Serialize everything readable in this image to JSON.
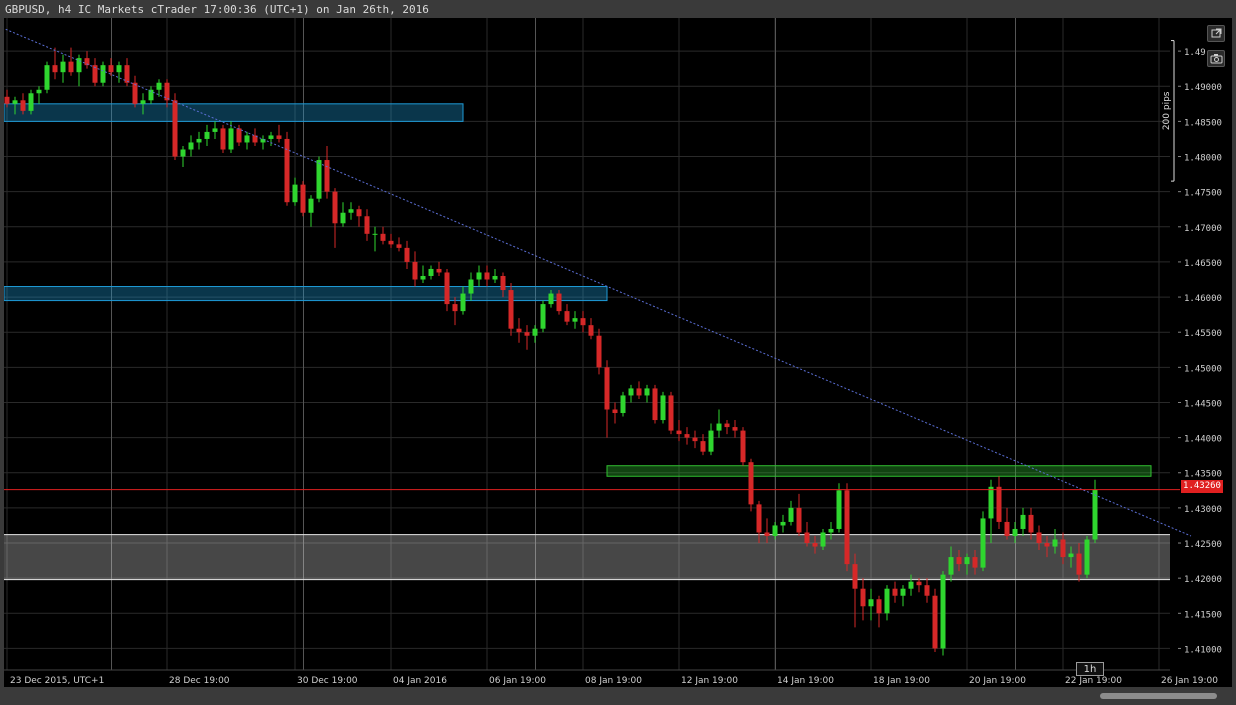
{
  "window": {
    "title": "GBPUSD, h4 IC Markets cTrader 17:00:36 (UTC+1) on Jan 26th, 2016",
    "timeframe_badge": "1h"
  },
  "colors": {
    "background": "#000000",
    "frame": "#3a3a3a",
    "grid": "#2a2a2a",
    "bull": "#2fd62f",
    "bear": "#d62828",
    "trendline": "#5b6fd6",
    "blue_zone": "#1e9bd7",
    "green_zone": "#30c030",
    "price_line": "#e02020",
    "axis_text": "#d0d0d0"
  },
  "chart_data": {
    "type": "candlestick",
    "symbol": "GBPUSD",
    "timeframe": "h4",
    "current_price": "1.43260",
    "ylim": [
      1.4075,
      1.499
    ],
    "y_ticks": [
      "1.49",
      "1.49000",
      "1.48500",
      "1.48000",
      "1.47500",
      "1.47000",
      "1.46500",
      "1.46000",
      "1.45500",
      "1.45000",
      "1.44500",
      "1.44000",
      "1.43500",
      "1.43000",
      "1.42500",
      "1.42000",
      "1.41500",
      "1.41000"
    ],
    "y_tick_values": [
      1.495,
      1.49,
      1.485,
      1.48,
      1.475,
      1.47,
      1.465,
      1.46,
      1.455,
      1.45,
      1.445,
      1.44,
      1.435,
      1.43,
      1.425,
      1.42,
      1.415,
      1.41
    ],
    "x_labels": [
      {
        "label": "23 Dec 2015, UTC+1",
        "bar": 0
      },
      {
        "label": "28 Dec 19:00",
        "bar": 20
      },
      {
        "label": "30 Dec 19:00",
        "bar": 36
      },
      {
        "label": "04 Jan 2016",
        "bar": 48
      },
      {
        "label": "06 Jan 19:00",
        "bar": 60
      },
      {
        "label": "08 Jan 19:00",
        "bar": 72
      },
      {
        "label": "12 Jan 19:00",
        "bar": 84
      },
      {
        "label": "14 Jan 19:00",
        "bar": 96
      },
      {
        "label": "18 Jan 19:00",
        "bar": 108
      },
      {
        "label": "20 Jan 19:00",
        "bar": 120
      },
      {
        "label": "22 Jan 19:00",
        "bar": 132
      },
      {
        "label": "26 Jan 19:00",
        "bar": 144
      }
    ],
    "vertical_gridlines_bars": [
      13,
      37,
      66,
      96,
      126
    ],
    "pips_label": "200 pips",
    "pips_range": [
      1.4965,
      1.4765
    ],
    "candles": [
      [
        1.4885,
        1.4895,
        1.487,
        1.4875
      ],
      [
        1.4875,
        1.4885,
        1.486,
        1.488
      ],
      [
        1.488,
        1.489,
        1.486,
        1.4865
      ],
      [
        1.4865,
        1.4895,
        1.486,
        1.489
      ],
      [
        1.489,
        1.49,
        1.4875,
        1.4895
      ],
      [
        1.4895,
        1.4935,
        1.489,
        1.493
      ],
      [
        1.493,
        1.4955,
        1.491,
        1.492
      ],
      [
        1.492,
        1.4945,
        1.4905,
        1.4935
      ],
      [
        1.4935,
        1.4955,
        1.4915,
        1.492
      ],
      [
        1.492,
        1.4945,
        1.49,
        1.494
      ],
      [
        1.494,
        1.495,
        1.4925,
        1.493
      ],
      [
        1.493,
        1.494,
        1.49,
        1.4905
      ],
      [
        1.4905,
        1.4935,
        1.49,
        1.493
      ],
      [
        1.493,
        1.494,
        1.4915,
        1.492
      ],
      [
        1.492,
        1.4935,
        1.4905,
        1.493
      ],
      [
        1.493,
        1.494,
        1.49,
        1.4905
      ],
      [
        1.4905,
        1.4915,
        1.487,
        1.4875
      ],
      [
        1.4875,
        1.489,
        1.486,
        1.488
      ],
      [
        1.488,
        1.49,
        1.4875,
        1.4895
      ],
      [
        1.4895,
        1.491,
        1.4885,
        1.4905
      ],
      [
        1.4905,
        1.491,
        1.487,
        1.488
      ],
      [
        1.488,
        1.489,
        1.4795,
        1.48
      ],
      [
        1.48,
        1.4815,
        1.4785,
        1.481
      ],
      [
        1.481,
        1.483,
        1.48,
        1.482
      ],
      [
        1.482,
        1.4835,
        1.481,
        1.4825
      ],
      [
        1.4825,
        1.4845,
        1.4815,
        1.4835
      ],
      [
        1.4835,
        1.485,
        1.4825,
        1.484
      ],
      [
        1.484,
        1.4845,
        1.4805,
        1.481
      ],
      [
        1.481,
        1.485,
        1.4805,
        1.484
      ],
      [
        1.484,
        1.4845,
        1.4815,
        1.482
      ],
      [
        1.482,
        1.4835,
        1.481,
        1.483
      ],
      [
        1.483,
        1.484,
        1.4815,
        1.482
      ],
      [
        1.482,
        1.483,
        1.481,
        1.4825
      ],
      [
        1.4825,
        1.4835,
        1.4815,
        1.483
      ],
      [
        1.483,
        1.4845,
        1.482,
        1.4825
      ],
      [
        1.4825,
        1.4835,
        1.473,
        1.4735
      ],
      [
        1.4735,
        1.477,
        1.473,
        1.476
      ],
      [
        1.476,
        1.4765,
        1.4715,
        1.472
      ],
      [
        1.472,
        1.4745,
        1.47,
        1.474
      ],
      [
        1.474,
        1.48,
        1.4735,
        1.4795
      ],
      [
        1.4795,
        1.4815,
        1.474,
        1.475
      ],
      [
        1.475,
        1.4755,
        1.467,
        1.4705
      ],
      [
        1.4705,
        1.4735,
        1.47,
        1.472
      ],
      [
        1.472,
        1.4735,
        1.471,
        1.4725
      ],
      [
        1.4725,
        1.473,
        1.47,
        1.4715
      ],
      [
        1.4715,
        1.4725,
        1.468,
        1.469
      ],
      [
        1.469,
        1.47,
        1.4665,
        1.469
      ],
      [
        1.469,
        1.47,
        1.4675,
        1.468
      ],
      [
        1.468,
        1.469,
        1.467,
        1.4675
      ],
      [
        1.4675,
        1.4685,
        1.4665,
        1.467
      ],
      [
        1.467,
        1.468,
        1.464,
        1.465
      ],
      [
        1.465,
        1.4665,
        1.4615,
        1.4625
      ],
      [
        1.4625,
        1.4645,
        1.462,
        1.463
      ],
      [
        1.463,
        1.4645,
        1.4625,
        1.464
      ],
      [
        1.464,
        1.465,
        1.463,
        1.4635
      ],
      [
        1.4635,
        1.464,
        1.458,
        1.459
      ],
      [
        1.459,
        1.46,
        1.456,
        1.458
      ],
      [
        1.458,
        1.4615,
        1.4575,
        1.4605
      ],
      [
        1.4605,
        1.4635,
        1.4595,
        1.4625
      ],
      [
        1.4625,
        1.4645,
        1.4615,
        1.4635
      ],
      [
        1.4635,
        1.4645,
        1.4615,
        1.4625
      ],
      [
        1.4625,
        1.464,
        1.462,
        1.463
      ],
      [
        1.463,
        1.4635,
        1.46,
        1.461
      ],
      [
        1.461,
        1.462,
        1.4545,
        1.4555
      ],
      [
        1.4555,
        1.457,
        1.4535,
        1.455
      ],
      [
        1.455,
        1.456,
        1.4525,
        1.4545
      ],
      [
        1.4545,
        1.456,
        1.4535,
        1.4555
      ],
      [
        1.4555,
        1.4595,
        1.455,
        1.459
      ],
      [
        1.459,
        1.461,
        1.4585,
        1.4605
      ],
      [
        1.4605,
        1.461,
        1.4575,
        1.458
      ],
      [
        1.458,
        1.459,
        1.456,
        1.4565
      ],
      [
        1.4565,
        1.458,
        1.4555,
        1.457
      ],
      [
        1.457,
        1.458,
        1.455,
        1.456
      ],
      [
        1.456,
        1.457,
        1.454,
        1.4545
      ],
      [
        1.4545,
        1.4555,
        1.449,
        1.45
      ],
      [
        1.45,
        1.451,
        1.44,
        1.444
      ],
      [
        1.444,
        1.445,
        1.442,
        1.4435
      ],
      [
        1.4435,
        1.4465,
        1.443,
        1.446
      ],
      [
        1.446,
        1.4475,
        1.445,
        1.447
      ],
      [
        1.447,
        1.448,
        1.4455,
        1.446
      ],
      [
        1.446,
        1.4475,
        1.445,
        1.447
      ],
      [
        1.447,
        1.4475,
        1.442,
        1.4425
      ],
      [
        1.4425,
        1.4465,
        1.442,
        1.446
      ],
      [
        1.446,
        1.4465,
        1.4405,
        1.441
      ],
      [
        1.441,
        1.4425,
        1.4395,
        1.4405
      ],
      [
        1.4405,
        1.4415,
        1.439,
        1.44
      ],
      [
        1.44,
        1.441,
        1.4385,
        1.4395
      ],
      [
        1.4395,
        1.4405,
        1.4375,
        1.438
      ],
      [
        1.438,
        1.442,
        1.4375,
        1.441
      ],
      [
        1.441,
        1.444,
        1.44,
        1.442
      ],
      [
        1.442,
        1.4425,
        1.4405,
        1.4415
      ],
      [
        1.4415,
        1.4425,
        1.44,
        1.441
      ],
      [
        1.441,
        1.4415,
        1.436,
        1.4365
      ],
      [
        1.4365,
        1.437,
        1.4295,
        1.4305
      ],
      [
        1.4305,
        1.431,
        1.425,
        1.4265
      ],
      [
        1.4265,
        1.4285,
        1.425,
        1.426
      ],
      [
        1.426,
        1.428,
        1.4255,
        1.4275
      ],
      [
        1.4275,
        1.429,
        1.4265,
        1.428
      ],
      [
        1.428,
        1.431,
        1.4275,
        1.43
      ],
      [
        1.43,
        1.432,
        1.426,
        1.4265
      ],
      [
        1.4265,
        1.428,
        1.4245,
        1.425
      ],
      [
        1.425,
        1.426,
        1.4235,
        1.4245
      ],
      [
        1.4245,
        1.427,
        1.424,
        1.4265
      ],
      [
        1.4265,
        1.428,
        1.4255,
        1.427
      ],
      [
        1.427,
        1.4335,
        1.4265,
        1.4325
      ],
      [
        1.4325,
        1.4335,
        1.421,
        1.422
      ],
      [
        1.422,
        1.4235,
        1.413,
        1.4185
      ],
      [
        1.4185,
        1.42,
        1.414,
        1.416
      ],
      [
        1.416,
        1.4185,
        1.414,
        1.417
      ],
      [
        1.417,
        1.4175,
        1.413,
        1.415
      ],
      [
        1.415,
        1.419,
        1.414,
        1.4185
      ],
      [
        1.4185,
        1.4195,
        1.4165,
        1.4175
      ],
      [
        1.4175,
        1.419,
        1.416,
        1.4185
      ],
      [
        1.4185,
        1.4205,
        1.4175,
        1.4195
      ],
      [
        1.4195,
        1.42,
        1.418,
        1.419
      ],
      [
        1.419,
        1.42,
        1.4165,
        1.4175
      ],
      [
        1.4175,
        1.4185,
        1.4095,
        1.41
      ],
      [
        1.41,
        1.421,
        1.409,
        1.4205
      ],
      [
        1.4205,
        1.4245,
        1.4195,
        1.423
      ],
      [
        1.423,
        1.424,
        1.421,
        1.422
      ],
      [
        1.422,
        1.4235,
        1.4205,
        1.423
      ],
      [
        1.423,
        1.424,
        1.4205,
        1.4215
      ],
      [
        1.4215,
        1.4295,
        1.421,
        1.4285
      ],
      [
        1.4285,
        1.434,
        1.425,
        1.433
      ],
      [
        1.433,
        1.4345,
        1.427,
        1.428
      ],
      [
        1.428,
        1.43,
        1.4255,
        1.426
      ],
      [
        1.426,
        1.428,
        1.425,
        1.427
      ],
      [
        1.427,
        1.43,
        1.426,
        1.429
      ],
      [
        1.429,
        1.43,
        1.4255,
        1.4265
      ],
      [
        1.4265,
        1.4275,
        1.424,
        1.425
      ],
      [
        1.425,
        1.426,
        1.423,
        1.4245
      ],
      [
        1.4245,
        1.427,
        1.4235,
        1.4255
      ],
      [
        1.4255,
        1.4265,
        1.422,
        1.423
      ],
      [
        1.423,
        1.4245,
        1.4215,
        1.4235
      ],
      [
        1.4235,
        1.425,
        1.4195,
        1.4205
      ],
      [
        1.4205,
        1.426,
        1.42,
        1.4255
      ],
      [
        1.4255,
        1.434,
        1.425,
        1.4326
      ]
    ],
    "trendline": {
      "start": [
        -2,
        1.499
      ],
      "end": [
        148,
        1.426
      ]
    },
    "zones": [
      {
        "color": "blue",
        "from_bar": 0,
        "to_bar": 57,
        "top": 1.4875,
        "bottom": 1.485
      },
      {
        "color": "blue",
        "from_bar": 0,
        "to_bar": 75,
        "top": 1.4615,
        "bottom": 1.4595
      },
      {
        "color": "green",
        "from_bar": 75,
        "to_bar": 143,
        "top": 1.436,
        "bottom": 1.4345
      }
    ],
    "range_band": {
      "top": 1.4262,
      "bottom": 1.4198
    }
  }
}
